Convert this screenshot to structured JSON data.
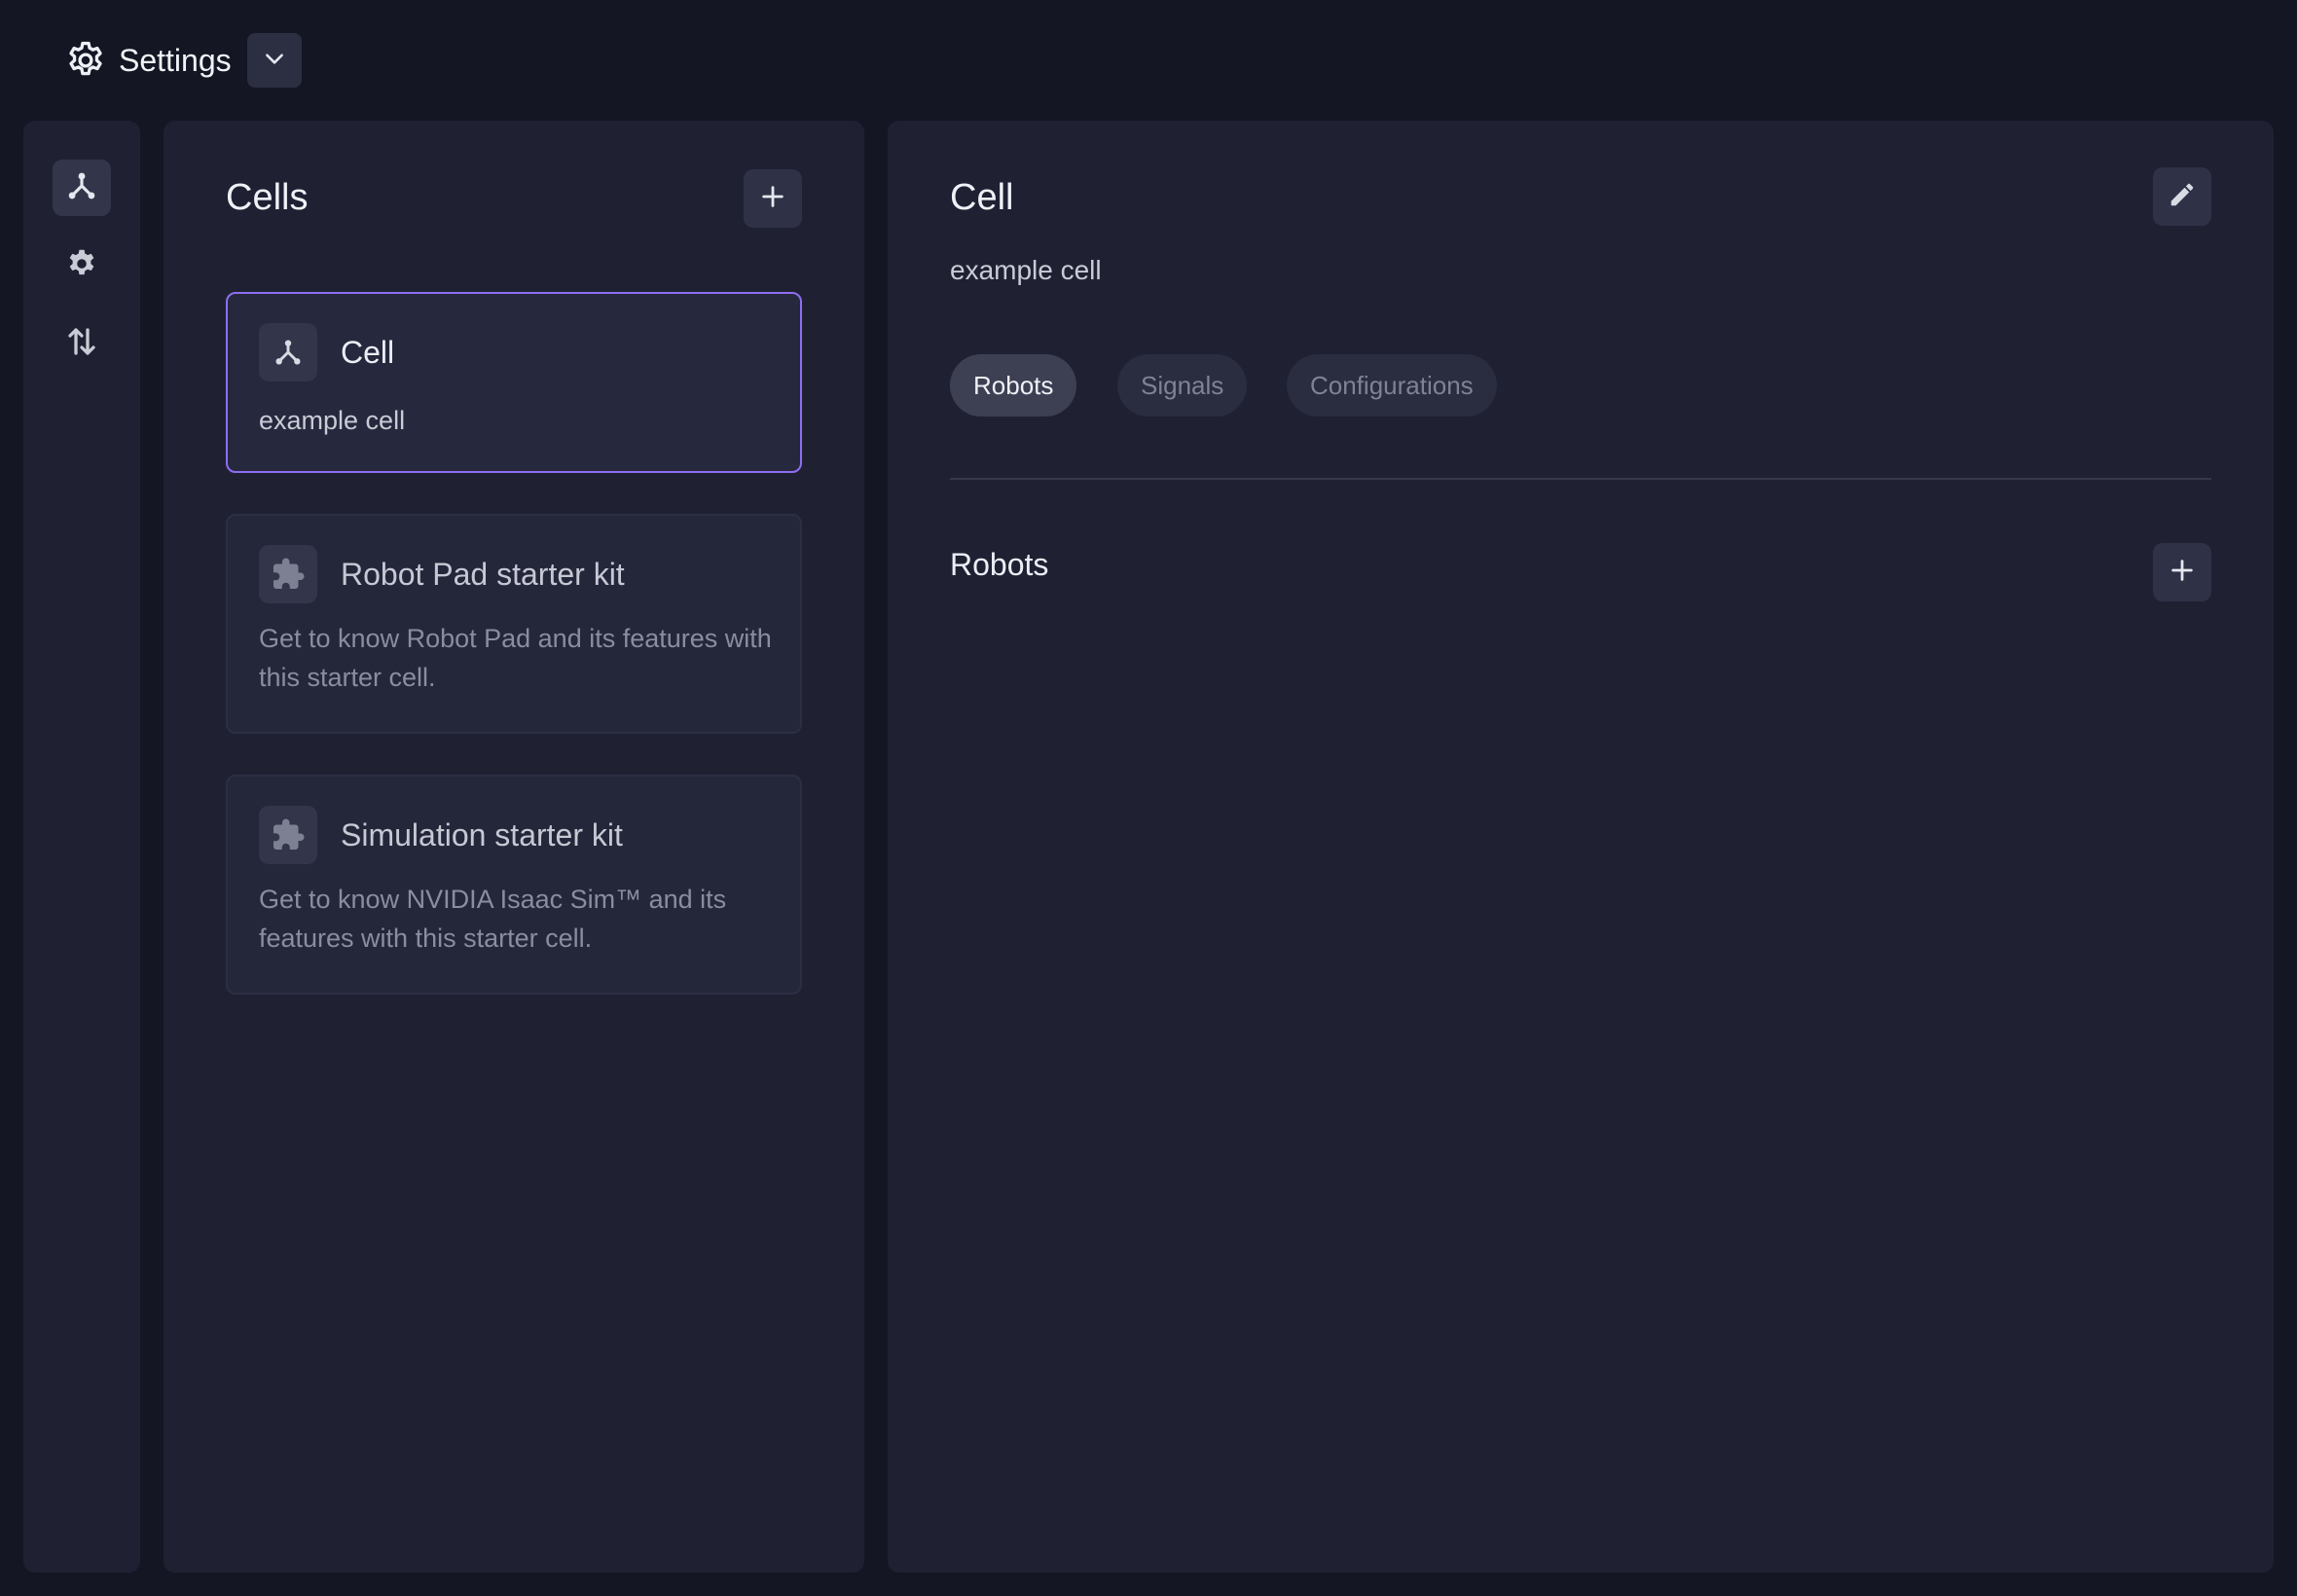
{
  "header": {
    "title": "Settings",
    "icon": "gear-icon",
    "dropdown_icon": "chevron-down-icon"
  },
  "rail": {
    "items": [
      {
        "icon": "cell-network-icon",
        "active": true
      },
      {
        "icon": "gear-icon",
        "active": false
      },
      {
        "icon": "transfer-arrows-icon",
        "active": false
      }
    ]
  },
  "cells_panel": {
    "title": "Cells",
    "add_icon": "plus-icon",
    "cards": [
      {
        "title": "Cell",
        "description": "example cell",
        "icon": "cell-network-icon",
        "selected": true
      },
      {
        "title": "Robot Pad starter kit",
        "description": "Get to know Robot Pad and its features with this starter cell.",
        "icon": "puzzle-icon",
        "selected": false
      },
      {
        "title": "Simulation starter kit",
        "description": "Get to know NVIDIA Isaac Sim™ and its features with this starter cell.",
        "icon": "puzzle-icon",
        "selected": false
      }
    ]
  },
  "detail_panel": {
    "title": "Cell",
    "subtitle": "example cell",
    "edit_icon": "pencil-icon",
    "tabs": [
      {
        "label": "Robots",
        "active": true
      },
      {
        "label": "Signals",
        "active": false
      },
      {
        "label": "Configurations",
        "active": false
      }
    ],
    "section": {
      "title": "Robots",
      "add_icon": "plus-icon"
    }
  },
  "colors": {
    "background": "#141624",
    "panel": "#1f2133",
    "accent": "#8e6ef0"
  }
}
